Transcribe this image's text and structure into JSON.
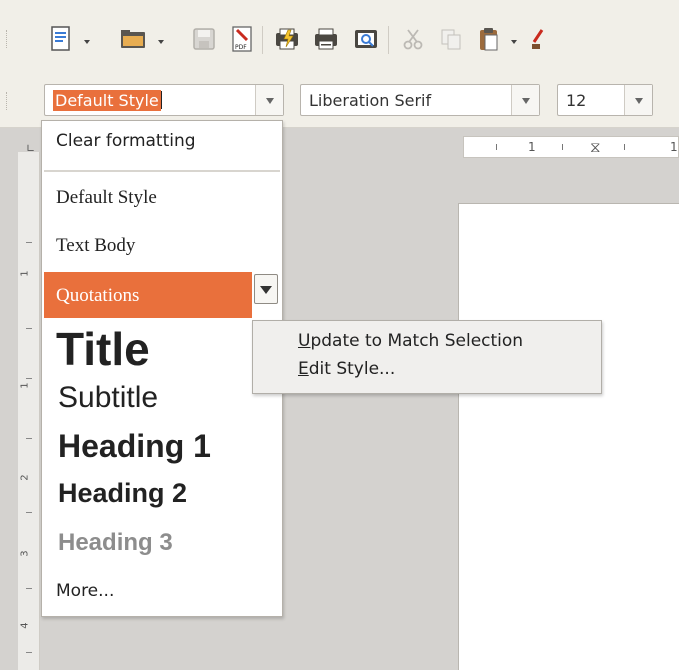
{
  "toolbar": {
    "icons": [
      "new-document-icon",
      "open-folder-icon",
      "save-icon",
      "export-pdf-icon",
      "print-direct-icon",
      "print-icon",
      "print-preview-icon",
      "cut-icon",
      "copy-icon",
      "paste-icon",
      "clone-formatting-icon"
    ]
  },
  "paragraph_style": {
    "value": "Default Style"
  },
  "font_name": {
    "value": "Liberation Serif"
  },
  "font_size": {
    "value": "12"
  },
  "ruler": {
    "h_label": "1",
    "h_label2": "1",
    "v_labels": [
      "1",
      "1",
      "2",
      "3",
      "4"
    ]
  },
  "style_dropdown": {
    "clear_label": "Clear formatting",
    "items": [
      {
        "label": "Default Style"
      },
      {
        "label": "Text Body"
      },
      {
        "label": "Quotations"
      },
      {
        "label": "Title"
      },
      {
        "label": "Subtitle"
      },
      {
        "label": "Heading 1"
      },
      {
        "label": "Heading 2"
      },
      {
        "label": "Heading 3"
      }
    ],
    "more_label": "More...",
    "highlight_color": "#e9703c"
  },
  "context_menu": {
    "items": [
      {
        "label": "Update to Match Selection"
      },
      {
        "label": "Edit Style..."
      }
    ]
  }
}
